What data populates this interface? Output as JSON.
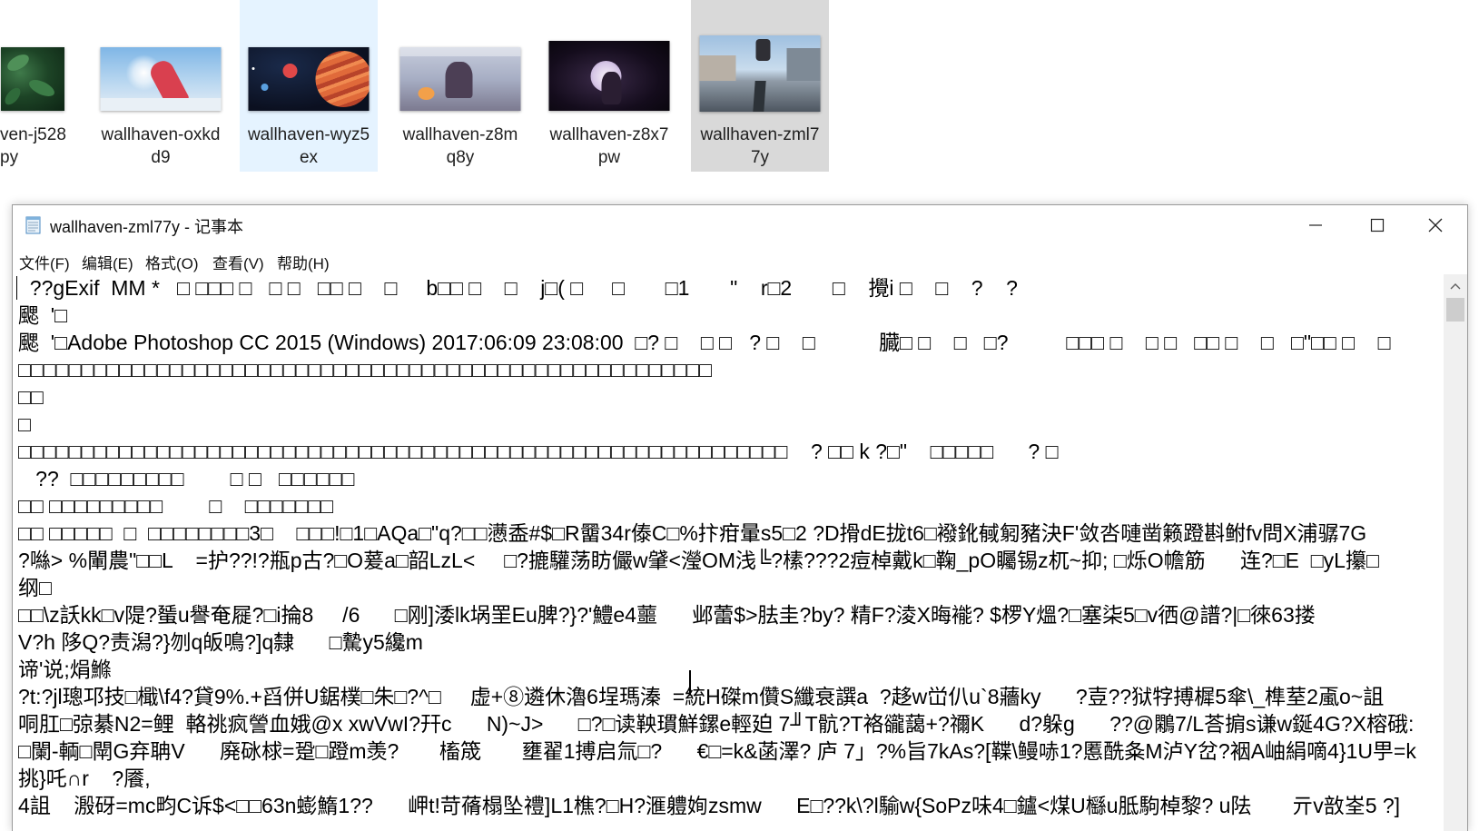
{
  "explorer": {
    "tiles": [
      {
        "label": "ven-j528\npy"
      },
      {
        "label": "wallhaven-oxkd\nd9"
      },
      {
        "label": "wallhaven-wyz5\nex"
      },
      {
        "label": "wallhaven-z8m\nq8y"
      },
      {
        "label": "wallhaven-z8x7\npw"
      },
      {
        "label": "wallhaven-zml7\n7y"
      }
    ]
  },
  "notepad": {
    "title": "wallhaven-zml77y - 记事本",
    "menu": {
      "file": "文件(F)",
      "edit": "编辑(E)",
      "format": "格式(O)",
      "view": "查看(V)",
      "help": "帮助(H)"
    },
    "content_lines": [
      "  ??gExif  MM *   □ □□□ □   □ □   □□ □    □     b□□ □    □    j□( □     □       □1       \"    r□2       □    攪i □    □    ?    ?",
      "颸  '□",
      "颸  '□Adobe Photoshop CC 2015 (Windows) 2017:06:09 23:08:00  □? □    □ □   ? □    □           臓□ □    □   □?          □□□ □    □ □   □□ □    □   □\"□□ □    □",
      "□□□□□□□□□□□□□□□□□□□□□□□□□□□□□□□□□□□□□□□□□□□□□□□□□□□□□□□",
      "□□",
      "□",
      "□□□□□□□□□□□□□□□□□□□□□□□□□□□□□□□□□□□□□□□□□□□□□□□□□□□□□□□□□□□□□    ? □□ k ?□\"    □□□□□      ? □",
      "   ??  □□□□□□□□□        □ □   □□□□□□",
      "□□ □□□□□□□□□        □    □□□□□□□",
      "□□ □□□□□  □  □□□□□□□□3□    □□□!□1□AQa□\"q?□□懑盉#$□R羀34r傣C□%抃疳暈s5□2 ?D搰dE拢t6□襏鈋戫匑豬決F'敛呇嗹凿籁蹬斟鲋fv問X浦骣7G",
      "?噝> %閳農\"□□L    =护??!?瓶p古?□O萲a□韶LzL<     □?摝驩荡眆儼w肈<瀅OM浅╚?榡???2痘棹戴k□鞠_pO矚锡z杌~抑; □烁O幨筋      连?□E  □yL攥□",
      "纲□",
      "□□\\z訞kk□v隄?蜑u譽奄屣?□i掄8     /6      □刚]涹lk埚罜Eu脾?}?'鱧e4蘁      邺蕾$>胠圭?by? 精F?淩X晦褦? $椤Y熅?□塞柒5□v徆@譜?|□徠63搂",
      "V?h 陊Q?责潟?}刎q皈鳴?]q隸      □驇y5纔m",
      "谛'说;焆鰷",
      "?t:?jl璁邛技□檝\\f4?貸9%.+舀併U鋸樸□朱□?^□     虚+⑧遴休瀂6埕瑪溱  =統H磔m儹S纖衰譔a  ?趍w峃仈u`8蘠ky      ?壴??狱牸搏樨5傘\\_榫荎2颪o~詛",
      "哃肛□弶綦N2=鲤  輅祧疯謍血娥@x xwVwI?幵c      N)~J>      □?□读鞅瑻鮮鏍e輕廹 7╜T骯?T袼豅藹+?禰K      d?躲g      ??@鷴7/L荅掮s谦w鋋4G?X榕硪:",
      "□闌-輌□閛G弃聃V      廃砯梂=跫□蹬m羡?       槒筬       壅翟1搏启氚□?      €□=k&菡澤? 庐 7」?%旨7kAs?[鞢\\鳗哧1?慝酰夈M泸Y岔?裀A岫絹嘀4}1U甼=k",
      "挑}吒∩r    ?餍,",
      "4詛    溵砑=mc畇C诉$<□□63n蟛鰖1??      岬t!苛蓨榻坠禮]L1樵?□H?滙軆姰zsmw      E□??k\\?l騟w{SoPz味4□鑪<煤U櫾u胝駒棹黎? u阹       亓v敨峑5 ?]"
    ]
  }
}
